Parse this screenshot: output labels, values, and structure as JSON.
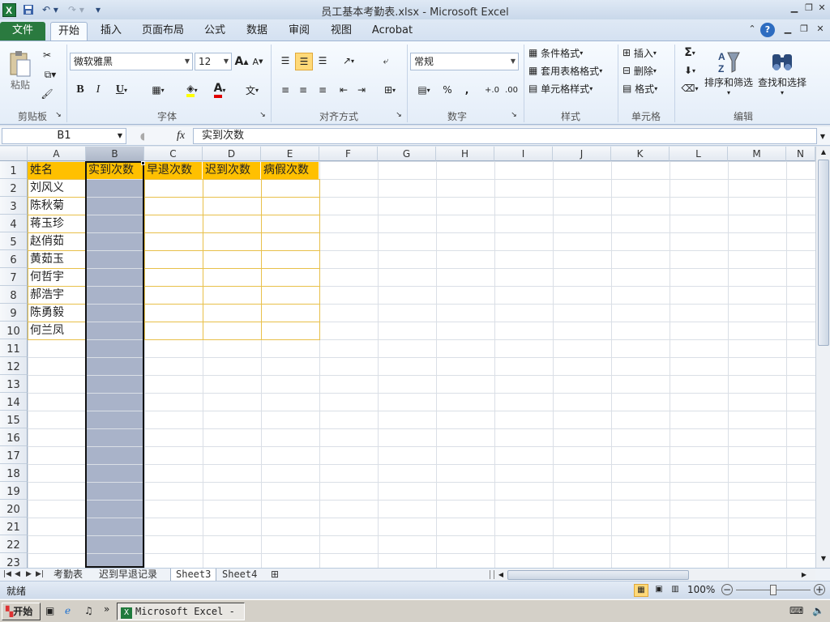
{
  "window": {
    "title": "员工基本考勤表.xlsx  -  Microsoft Excel",
    "app_icon_letter": "X"
  },
  "tabs": [
    {
      "label": "文件"
    },
    {
      "label": "开始"
    },
    {
      "label": "插入"
    },
    {
      "label": "页面布局"
    },
    {
      "label": "公式"
    },
    {
      "label": "数据"
    },
    {
      "label": "审阅"
    },
    {
      "label": "视图"
    },
    {
      "label": "Acrobat"
    }
  ],
  "ribbon": {
    "clipboard": {
      "label": "剪贴板",
      "paste": "粘贴"
    },
    "font": {
      "label": "字体",
      "name": "微软雅黑",
      "size": "12",
      "bold": "B",
      "italic": "I",
      "underline": "U",
      "grow": "A",
      "shrink": "A",
      "fill_letter": "A"
    },
    "alignment": {
      "label": "对齐方式"
    },
    "number": {
      "label": "数字",
      "format": "常规",
      "percent": "%",
      "comma": ","
    },
    "styles": {
      "label": "样式",
      "cond": "条件格式",
      "table": "套用表格格式",
      "cell": "单元格样式"
    },
    "cells": {
      "label": "单元格",
      "insert": "插入",
      "delete": "删除",
      "format": "格式"
    },
    "editing": {
      "label": "编辑",
      "sigma": "Σ",
      "sort": "排序和筛选",
      "find": "查找和选择"
    }
  },
  "formula_bar": {
    "name_box": "B1",
    "fx": "fx",
    "value": "实到次数"
  },
  "columns": [
    "A",
    "B",
    "C",
    "D",
    "E",
    "F",
    "G",
    "H",
    "I",
    "J",
    "K",
    "L",
    "M",
    "N"
  ],
  "rows": [
    "1",
    "2",
    "3",
    "4",
    "5",
    "6",
    "7",
    "8",
    "9",
    "10",
    "11",
    "12",
    "13",
    "14",
    "15",
    "16",
    "17",
    "18",
    "19",
    "20",
    "21",
    "22",
    "23"
  ],
  "headers": [
    "姓名",
    "实到次数",
    "早退次数",
    "迟到次数",
    "病假次数"
  ],
  "names": [
    "刘风义",
    "陈秋菊",
    "蒋玉珍",
    "赵俏茹",
    "黄茹玉",
    "何哲宇",
    "郝浩宇",
    "陈勇毅",
    "何兰凤"
  ],
  "sheets": [
    "考勤表",
    "迟到早退记录",
    "Sheet3",
    "Sheet4"
  ],
  "status": {
    "ready": "就绪",
    "zoom": "100%"
  },
  "taskbar": {
    "start": "开始",
    "excel_button": "Microsoft Excel - ...",
    "more": "»"
  },
  "colors": {
    "header_fill": "#ffc000",
    "selection": "#a9b3c9",
    "file_tab": "#2a7a3f"
  }
}
